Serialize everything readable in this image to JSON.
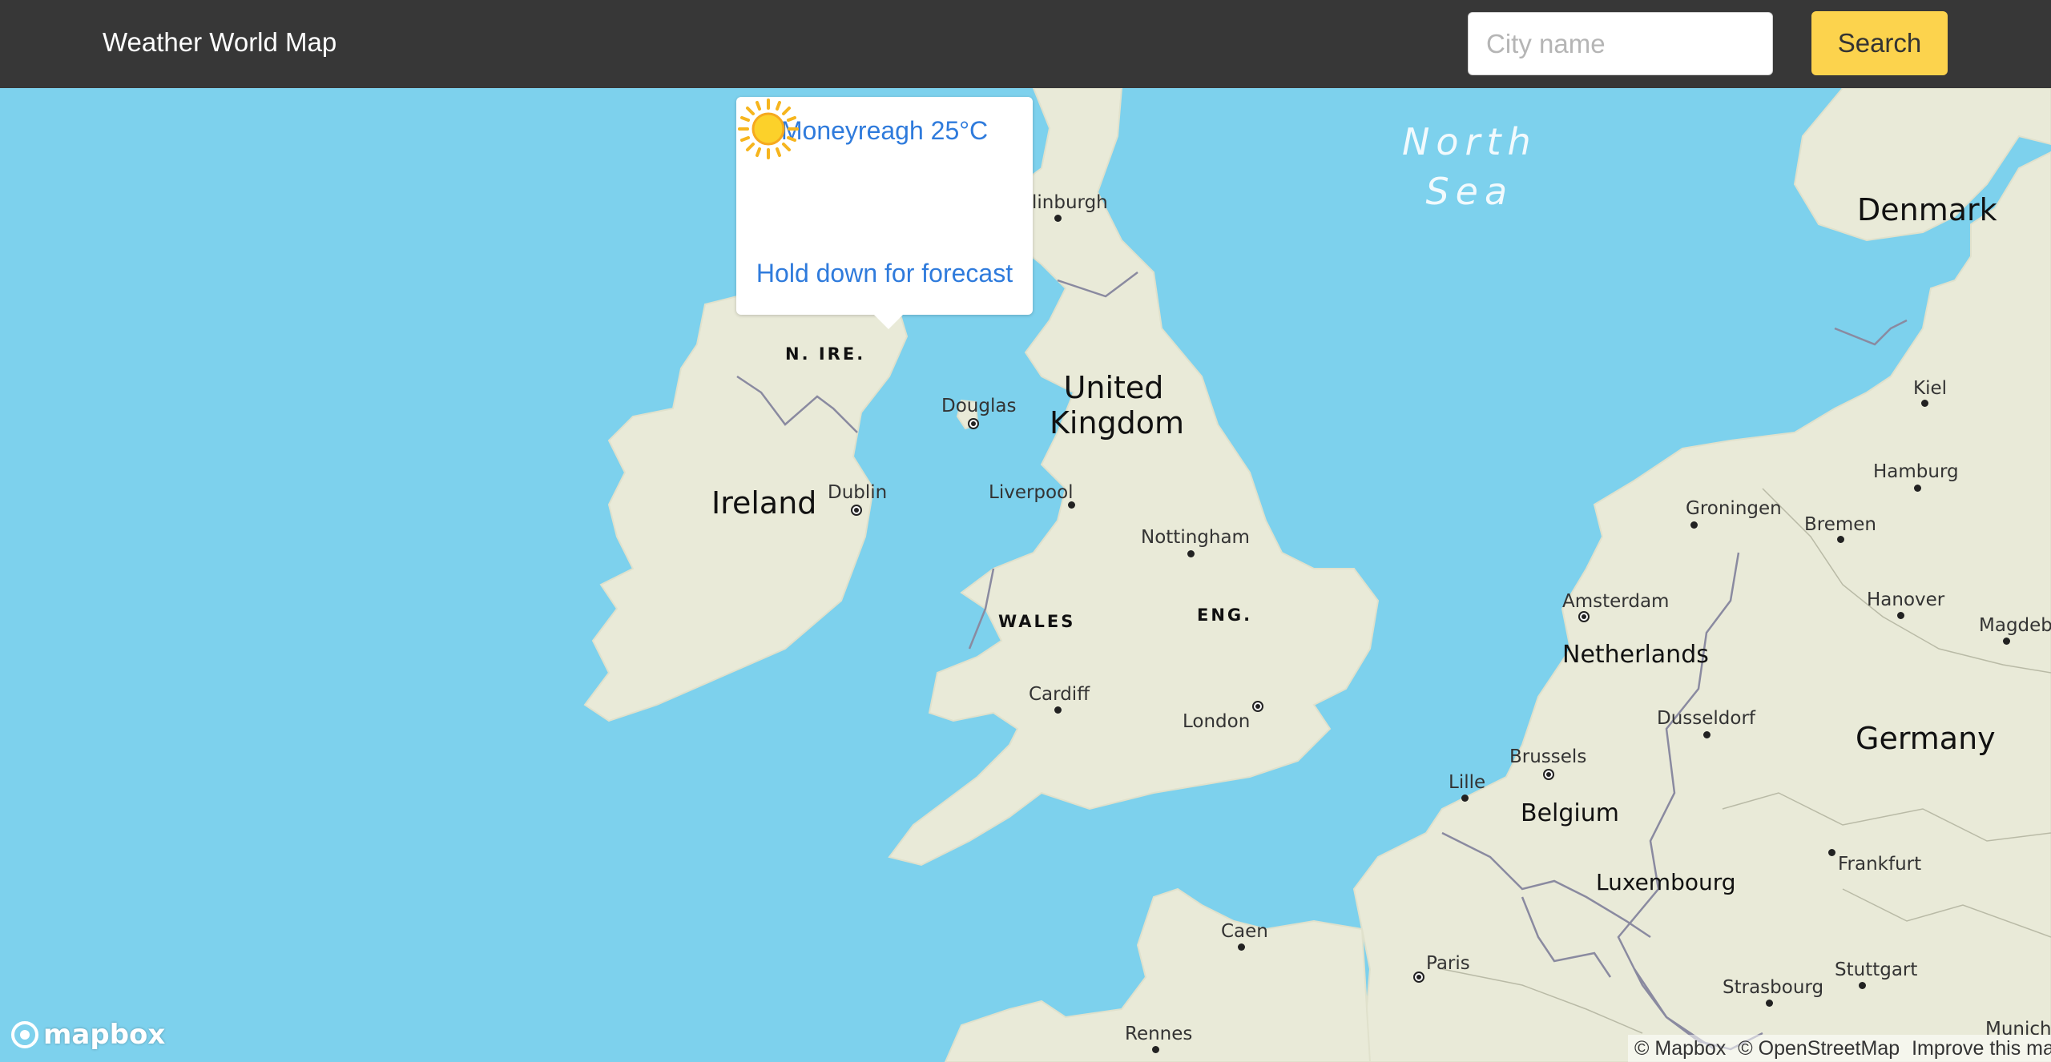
{
  "header": {
    "title": "Weather World Map",
    "search_placeholder": "City name",
    "search_value": "",
    "search_button": "Search"
  },
  "popup": {
    "title": "Moneyreagh 25°C",
    "icon": "sun-icon",
    "hint": "Hold down for forecast"
  },
  "map": {
    "countries": [
      "Ireland",
      "United Kingdom",
      "Netherlands",
      "Belgium",
      "Luxembourg",
      "Germany",
      "Denmark"
    ],
    "regions": [
      "N. IRE.",
      "WALES",
      "ENG."
    ],
    "seas": [
      "North Sea"
    ],
    "cities": [
      "linburgh",
      "Douglas",
      "Dublin",
      "Liverpool",
      "Nottingham",
      "Cardiff",
      "London",
      "Groningen",
      "Amsterdam",
      "Bremen",
      "Hamburg",
      "Kiel",
      "Hanover",
      "Magdebu",
      "Dusseldorf",
      "Brussels",
      "Lille",
      "Frankfurt",
      "Caen",
      "Paris",
      "Strasbourg",
      "Stuttgart",
      "Rennes",
      "Munich"
    ],
    "colors": {
      "water": "#7dd1ed",
      "land": "#e9ead8",
      "border": "#8a8aa0"
    }
  },
  "footer": {
    "logo": "mapbox",
    "attribution": [
      "© Mapbox",
      "© OpenStreetMap",
      "Improve this map"
    ]
  }
}
